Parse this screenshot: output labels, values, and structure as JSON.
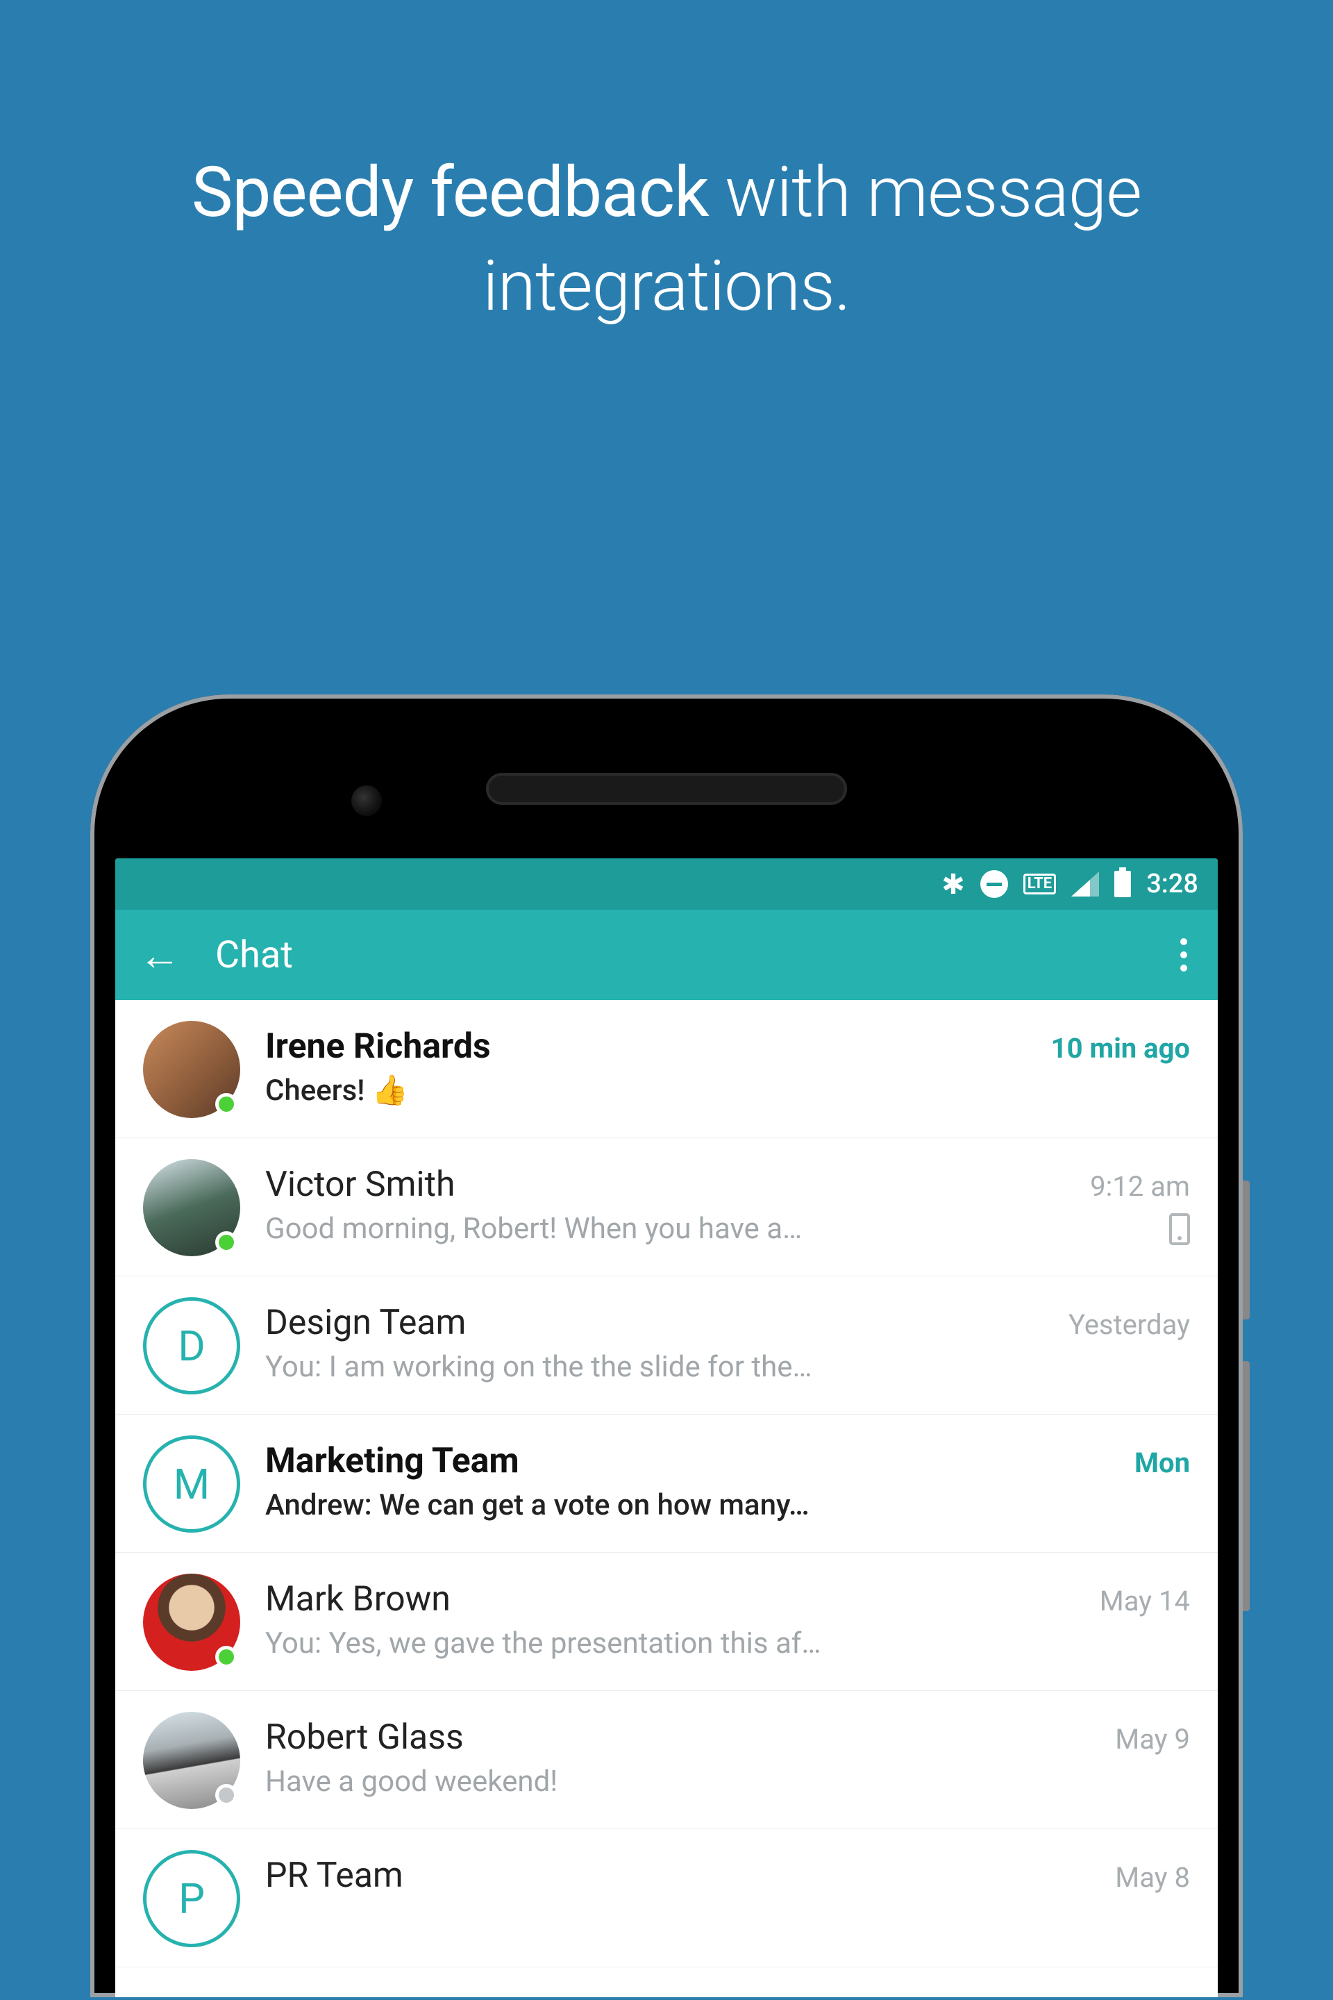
{
  "headline": {
    "bold": "Speedy feedback",
    "rest": " with message integrations."
  },
  "statusbar": {
    "lte": "LTE",
    "time": "3:28"
  },
  "appbar": {
    "title": "Chat"
  },
  "chats": [
    {
      "name": "Irene Richards",
      "time": "10 min ago",
      "preview": "Cheers!  👍",
      "unread": true,
      "avatarType": "photo",
      "avatarClass": "av1",
      "presence": "online",
      "device": false
    },
    {
      "name": "Victor Smith",
      "time": "9:12 am",
      "preview": "Good morning, Robert!  When you have a…",
      "unread": false,
      "avatarType": "photo",
      "avatarClass": "av2",
      "presence": "online",
      "device": true
    },
    {
      "name": "Design Team",
      "time": "Yesterday",
      "preview": "You: I am working on the the slide for the…",
      "unread": false,
      "avatarType": "initial",
      "initial": "D",
      "presence": null,
      "device": false
    },
    {
      "name": "Marketing Team",
      "time": "Mon",
      "preview": "Andrew: We can get a vote on how many…",
      "unread": true,
      "avatarType": "initial",
      "initial": "M",
      "presence": null,
      "device": false
    },
    {
      "name": "Mark Brown",
      "time": "May 14",
      "preview": "You: Yes, we gave the presentation this af…",
      "unread": false,
      "avatarType": "photo",
      "avatarClass": "av5",
      "presence": "online",
      "device": false
    },
    {
      "name": "Robert Glass",
      "time": "May 9",
      "preview": "Have a good weekend!",
      "unread": false,
      "avatarType": "photo",
      "avatarClass": "av6",
      "presence": "offline",
      "device": false
    },
    {
      "name": "PR Team",
      "time": "May 8",
      "preview": "",
      "unread": false,
      "avatarType": "initial",
      "initial": "P",
      "presence": null,
      "device": false
    }
  ]
}
